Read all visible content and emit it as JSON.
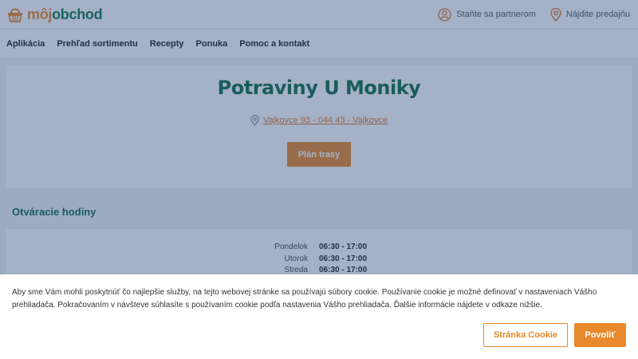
{
  "header": {
    "logo_prefix": "môj",
    "logo_suffix": "obchod",
    "links": [
      {
        "label": "Staňte sa partnerom",
        "icon": "user-circle-icon"
      },
      {
        "label": "Nájdite predajňu",
        "icon": "location-pin-icon"
      }
    ]
  },
  "nav": {
    "items": [
      "Aplikácia",
      "Prehľad sortimentu",
      "Recepty",
      "Ponuka",
      "Pomoc a kontakt"
    ]
  },
  "store": {
    "title": "Potraviny U Moniky",
    "address": "Vajkovce 93 - 044 43 - Vajkovce",
    "route_button": "Plán trasy"
  },
  "hours": {
    "heading": "Otváracie hodiny",
    "rows": [
      {
        "day": "Pondelok",
        "time": "06:30 - 17:00"
      },
      {
        "day": "Utorok",
        "time": "06:30 - 17:00"
      },
      {
        "day": "Streda",
        "time": "06:30 - 17:00"
      }
    ]
  },
  "cookie": {
    "text": "Aby sme Vám mohli poskytnúť čo najlepšie služby, na tejto webovej stránke sa používajú súbory cookie. Používanie cookie je možné definovať v nastaveniach Vášho prehliadača. Pokračovaním v návšteve súhlasíte s používaním cookie podľa nastavenia Vášho prehliadača. Ďalšie informácie nájdete v odkaze nižšie.",
    "cookie_page_button": "Stránka Cookie",
    "allow_button": "Povoliť"
  },
  "colors": {
    "brand_green": "#0e7a4f",
    "accent_orange": "#e8892b",
    "overlay": "rgba(40,70,120,0.42)"
  }
}
